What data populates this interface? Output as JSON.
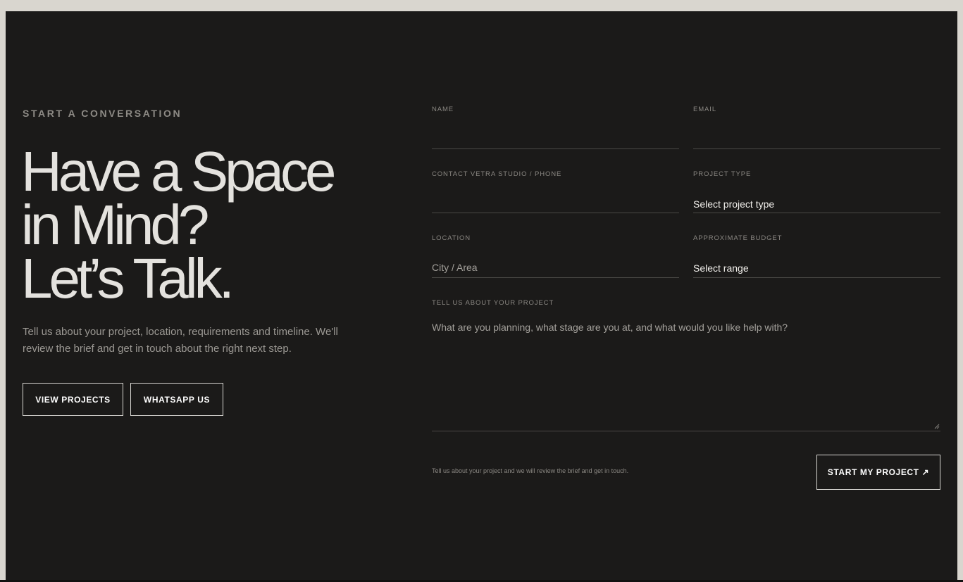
{
  "hero": {
    "eyebrow": "START A CONVERSATION",
    "headline_line1": "Have a Space",
    "headline_line2": "in Mind?",
    "headline_line3": "Let’s Talk.",
    "intro": "Tell us about your project, location, requirements and timeline. We'll review the brief and get in touch about the right next step.",
    "view_projects_label": "VIEW PROJECTS",
    "whatsapp_label": "WHATSAPP US"
  },
  "form": {
    "name_label": "NAME",
    "name_value": "",
    "email_label": "EMAIL",
    "email_value": "",
    "phone_label": "CONTACT VETRA STUDIO / PHONE",
    "phone_value": "",
    "project_type_label": "PROJECT TYPE",
    "project_type_value": "Select project type",
    "location_label": "LOCATION",
    "location_placeholder": "City / Area",
    "budget_label": "APPROXIMATE BUDGET",
    "budget_value": "Select range",
    "message_label": "TELL US ABOUT YOUR PROJECT",
    "message_placeholder": "What are you planning, what stage are you at, and what would you like help with?",
    "note": "Tell us about your project and we will review the brief and get in touch.",
    "submit_label": "START MY PROJECT ↗"
  },
  "colors": {
    "page_bg": "#d9d6cf",
    "panel_bg": "#1b1a19",
    "text_primary": "#e4e2de",
    "text_muted": "#8d8a85",
    "border": "#4a4845"
  }
}
